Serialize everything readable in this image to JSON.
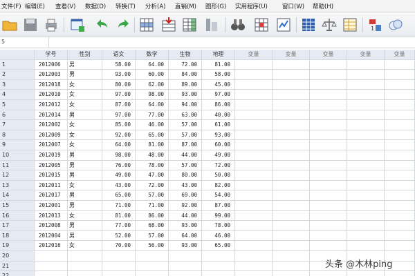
{
  "menu": [
    "文件(F)",
    "编辑(E)",
    "查看(V)",
    "数据(D)",
    "转换(T)",
    "分析(A)",
    "直销(M)",
    "图形(G)",
    "实用程序(U)",
    "窗口(W)",
    "帮助(H)"
  ],
  "toolbar_icons": [
    "open-folder-icon",
    "save-icon",
    "print-icon",
    "dialog-recall-icon",
    "undo-icon",
    "redo-icon",
    "goto-case-icon",
    "goto-variable-icon",
    "variables-icon",
    "run-descriptive-icon",
    "find-icon",
    "insert-cases-icon",
    "insert-variable-icon",
    "split-file-icon",
    "weight-cases-icon",
    "select-cases-icon",
    "value-labels-icon",
    "use-sets-icon"
  ],
  "cell_ref": "5",
  "columns": [
    "学号",
    "性别",
    "语文",
    "数学",
    "生物",
    "地理",
    "变量",
    "变量",
    "变量",
    "变量",
    "变量"
  ],
  "rows": [
    {
      "n": "1",
      "id": "2012006",
      "sex": "男",
      "yw": "58.00",
      "sx": "64.00",
      "sw": "72.00",
      "dl": "81.00"
    },
    {
      "n": "2",
      "id": "2012003",
      "sex": "男",
      "yw": "93.00",
      "sx": "60.00",
      "sw": "84.00",
      "dl": "58.00"
    },
    {
      "n": "3",
      "id": "2012018",
      "sex": "女",
      "yw": "80.00",
      "sx": "62.00",
      "sw": "89.00",
      "dl": "45.00"
    },
    {
      "n": "4",
      "id": "2012010",
      "sex": "女",
      "yw": "97.00",
      "sx": "98.00",
      "sw": "93.00",
      "dl": "97.00"
    },
    {
      "n": "5",
      "id": "2012012",
      "sex": "女",
      "yw": "87.00",
      "sx": "64.00",
      "sw": "94.00",
      "dl": "86.00"
    },
    {
      "n": "6",
      "id": "2012014",
      "sex": "男",
      "yw": "97.00",
      "sx": "77.00",
      "sw": "63.00",
      "dl": "40.00"
    },
    {
      "n": "7",
      "id": "2012002",
      "sex": "女",
      "yw": "85.00",
      "sx": "46.00",
      "sw": "57.00",
      "dl": "61.00"
    },
    {
      "n": "8",
      "id": "2012009",
      "sex": "女",
      "yw": "92.00",
      "sx": "65.00",
      "sw": "57.00",
      "dl": "93.00"
    },
    {
      "n": "9",
      "id": "2012007",
      "sex": "女",
      "yw": "64.00",
      "sx": "81.00",
      "sw": "87.00",
      "dl": "60.00"
    },
    {
      "n": "10",
      "id": "2012019",
      "sex": "男",
      "yw": "98.00",
      "sx": "48.00",
      "sw": "44.00",
      "dl": "49.00"
    },
    {
      "n": "11",
      "id": "2012005",
      "sex": "男",
      "yw": "76.00",
      "sx": "78.00",
      "sw": "57.00",
      "dl": "72.00"
    },
    {
      "n": "12",
      "id": "2012015",
      "sex": "男",
      "yw": "49.00",
      "sx": "47.00",
      "sw": "80.00",
      "dl": "50.00"
    },
    {
      "n": "13",
      "id": "2012011",
      "sex": "女",
      "yw": "43.00",
      "sx": "72.00",
      "sw": "43.00",
      "dl": "82.00"
    },
    {
      "n": "14",
      "id": "2012017",
      "sex": "男",
      "yw": "65.00",
      "sx": "57.00",
      "sw": "69.00",
      "dl": "54.00"
    },
    {
      "n": "15",
      "id": "2012001",
      "sex": "男",
      "yw": "71.00",
      "sx": "71.00",
      "sw": "92.00",
      "dl": "87.00"
    },
    {
      "n": "16",
      "id": "2012013",
      "sex": "女",
      "yw": "81.00",
      "sx": "86.00",
      "sw": "44.00",
      "dl": "99.00"
    },
    {
      "n": "17",
      "id": "2012008",
      "sex": "男",
      "yw": "77.00",
      "sx": "68.00",
      "sw": "93.00",
      "dl": "78.00"
    },
    {
      "n": "18",
      "id": "2012004",
      "sex": "男",
      "yw": "52.00",
      "sx": "57.00",
      "sw": "64.00",
      "dl": "46.00"
    },
    {
      "n": "19",
      "id": "2012016",
      "sex": "女",
      "yw": "70.00",
      "sx": "56.00",
      "sw": "93.00",
      "dl": "65.00"
    }
  ],
  "empty_rows": [
    "20",
    "21",
    "22"
  ],
  "watermark": "头条 @木林ping"
}
